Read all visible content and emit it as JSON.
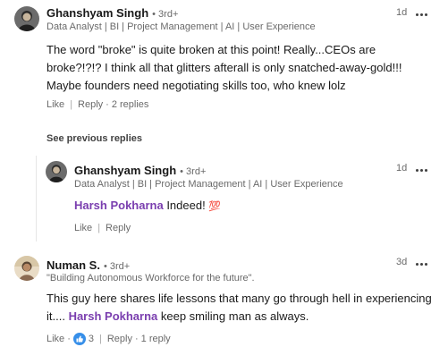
{
  "comments": [
    {
      "author": "Ghanshyam Singh",
      "degree": "• 3rd+",
      "headline": "Data Analyst | BI | Project Management | AI | User Experience",
      "time": "1d",
      "text": "The word \"broke\" is quite broken at this point! Really...CEOs are broke?!?!? I think all that glitters afterall is only snatched-away-gold!!! Maybe founders need negotiating skills too, who knew lolz",
      "like_label": "Like",
      "reply_label": "Reply",
      "reply_count": "2 replies",
      "avatar_icon": "person-avatar-dark"
    }
  ],
  "see_previous_label": "See previous replies",
  "reply": {
    "author": "Ghanshyam Singh",
    "degree": "• 3rd+",
    "headline": "Data Analyst | BI | Project Management | AI | User Experience",
    "time": "1d",
    "mention": "Harsh Pokharna",
    "text": " Indeed! ",
    "emoji": "💯",
    "like_label": "Like",
    "reply_label": "Reply"
  },
  "second": {
    "author": "Numan S.",
    "degree": "• 3rd+",
    "headline": "\"Building Autonomous Workforce for the future\".",
    "time": "3d",
    "text_before": "This guy here shares life lessons that many go through hell in experiencing it.... ",
    "mention": "Harsh Pokharna",
    "text_after": " keep smiling man as always.",
    "like_label": "Like",
    "reaction_count": "3",
    "reaction_icon": "thumbs-up-icon",
    "reply_label": "Reply",
    "reply_count": "1 reply"
  },
  "colors": {
    "mention": "#7a3eaf",
    "like_reaction": "#378fe9"
  }
}
